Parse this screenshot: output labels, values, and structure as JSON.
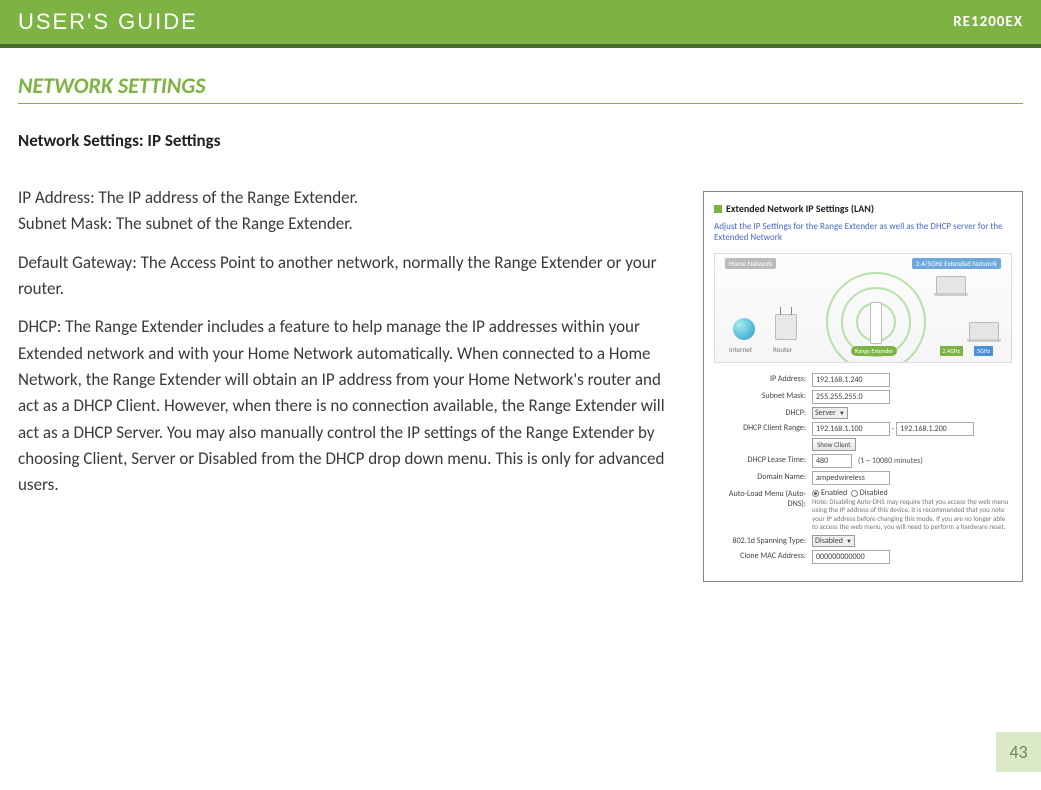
{
  "header": {
    "title": "USER'S GUIDE",
    "model": "RE1200EX"
  },
  "section_title": "NETWORK SETTINGS",
  "subsection": "Network Settings: IP Settings",
  "paragraphs": {
    "p1a": "IP Address: The IP address of the Range Extender.",
    "p1b": "Subnet Mask: The subnet of the Range Extender.",
    "p2": "Default Gateway: The Access Point to another network, normally the Range Extender or your router.",
    "p3": "DHCP: The Range Extender includes a feature to help manage the IP addresses within your Extended network and with your Home Network automatically. When connected to a Home Network, the Range Extender will obtain an IP address from your Home Network's router and act as a DHCP Client. However, when there is no connection available, the Range Extender will act as a DHCP Server. You may also manually control the IP settings of the Range Extender by choosing Client, Server or Disabled from the DHCP drop down menu. This is only for advanced users."
  },
  "panel": {
    "title": "Extended Network IP Settings (LAN)",
    "subtitle": "Adjust the IP Settings for the Range Extender as well as the DHCP server for the Extended Network",
    "diagram": {
      "home_tag": "Home Network",
      "ext_tag": "2.4/5GHz Extended Network",
      "internet": "Internet",
      "router": "Router",
      "range_extender": "Range Extender",
      "b24": "2.4GHz",
      "b5": "5GHz"
    },
    "form": {
      "ip_label": "IP Address:",
      "ip_value": "192.168.1.240",
      "subnet_label": "Subnet Mask:",
      "subnet_value": "255.255.255.0",
      "dhcp_label": "DHCP:",
      "dhcp_value": "Server",
      "range_label": "DHCP Client Range:",
      "range_start": "192.168.1.100",
      "range_sep": " - ",
      "range_end": "192.168.1.200",
      "show_client": "Show Client",
      "lease_label": "DHCP Lease Time:",
      "lease_value": "480",
      "lease_hint": "(1 ~ 10080 minutes)",
      "domain_label": "Domain Name:",
      "domain_value": "ampedwireless",
      "autodns_label": "Auto-Load Menu (Auto-DNS):",
      "autodns_enabled": "Enabled",
      "autodns_disabled": "Disabled",
      "autodns_note": "Note: Disabling Auto-DNS may require that you access the web menu using the IP address of this device. It is recommended that you note your IP address before changing this mode. If you are no longer able to access the web menu, you will need to perform a hardware reset.",
      "spanning_label": "802.1d Spanning Type:",
      "spanning_value": "Disabled",
      "mac_label": "Clone MAC Address:",
      "mac_value": "000000000000"
    }
  },
  "page_number": "43"
}
